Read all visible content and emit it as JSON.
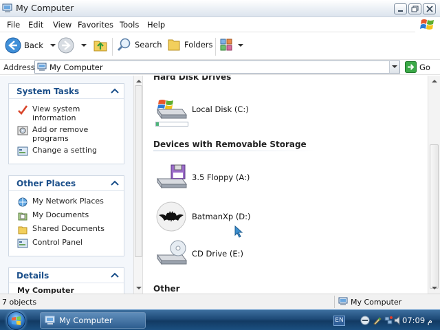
{
  "window": {
    "title": "My Computer"
  },
  "menu": [
    "File",
    "Edit",
    "View",
    "Favorites",
    "Tools",
    "Help"
  ],
  "toolbar": {
    "back": "Back",
    "search": "Search",
    "folders": "Folders"
  },
  "address": {
    "label": "Address",
    "value": "My Computer",
    "go": "Go"
  },
  "left_pane": {
    "system_tasks": {
      "title": "System Tasks",
      "items": [
        "View system information",
        "Add or remove programs",
        "Change a setting"
      ]
    },
    "other_places": {
      "title": "Other Places",
      "items": [
        "My Network Places",
        "My Documents",
        "Shared Documents",
        "Control Panel"
      ]
    },
    "details": {
      "title": "Details",
      "partial": "My Computer"
    }
  },
  "content": {
    "hard_disk_drives": {
      "title": "Hard Disk Drives",
      "drives": [
        {
          "label": "Local Disk (C:)",
          "usage": 0.08
        }
      ]
    },
    "removable": {
      "title": "Devices with Removable Storage",
      "drives": [
        "3.5 Floppy (A:)",
        "BatmanXp (D:)",
        "CD Drive (E:)"
      ]
    },
    "other": {
      "title": "Other"
    }
  },
  "status": {
    "left": "7 objects",
    "right": "My Computer"
  },
  "taskbar": {
    "task": "My Computer",
    "lang": "EN",
    "clock": "07:09 م"
  },
  "colors": {
    "accent": "#1b4f8a",
    "taskbar": "#1e4a77",
    "progress": "#4fb57a"
  }
}
